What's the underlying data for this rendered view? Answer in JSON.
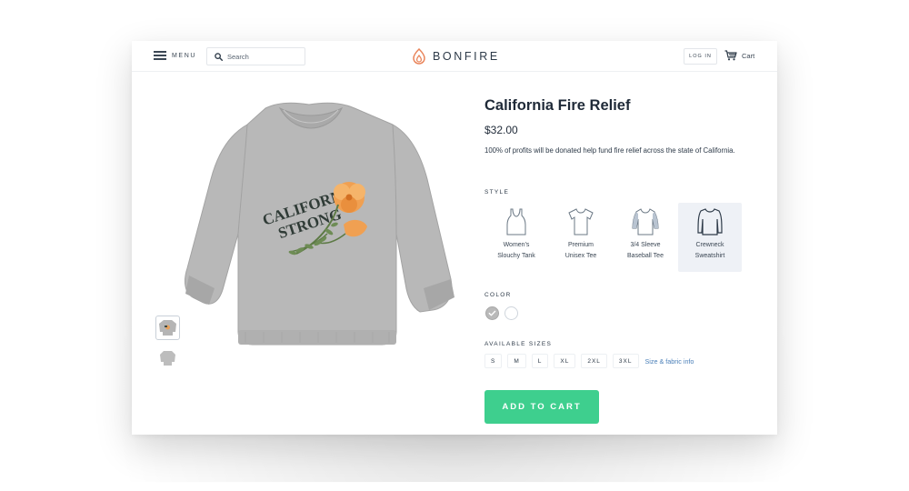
{
  "header": {
    "menu_label": "MENU",
    "search_placeholder": "Search",
    "logo_text": "BONFIRE",
    "login_label": "LOG IN",
    "cart_label": "Cart"
  },
  "product": {
    "title": "California Fire Relief",
    "price": "$32.00",
    "description": "100% of profits will be donated help fund fire relief across the state of California.",
    "style_label": "STYLE",
    "styles": [
      {
        "label": "Women's\nSlouchy Tank",
        "icon": "tank-top-icon",
        "selected": false
      },
      {
        "label": "Premium\nUnisex Tee",
        "icon": "tshirt-icon",
        "selected": false
      },
      {
        "label": "3/4 Sleeve\nBaseball Tee",
        "icon": "baseball-tee-icon",
        "selected": false
      },
      {
        "label": "Crewneck\nSweatshirt",
        "icon": "sweatshirt-icon",
        "selected": true
      }
    ],
    "color_label": "COLOR",
    "colors": [
      {
        "name": "heather-grey",
        "hex": "#b9b9b9",
        "selected": true
      },
      {
        "name": "white",
        "hex": "#ffffff",
        "selected": false
      }
    ],
    "sizes_label": "AVAILABLE SIZES",
    "sizes": [
      "S",
      "M",
      "L",
      "XL",
      "2XL",
      "3XL"
    ],
    "size_info_link": "Size & fabric info",
    "add_to_cart": "ADD TO CART",
    "graphic_text": [
      "CALIFORNIA",
      "STRONG"
    ]
  },
  "colors": {
    "accent_green": "#3ecf8e",
    "logo_orange": "#e9845a",
    "link_blue": "#4a7fb8",
    "text_dark": "#1f2a38"
  }
}
